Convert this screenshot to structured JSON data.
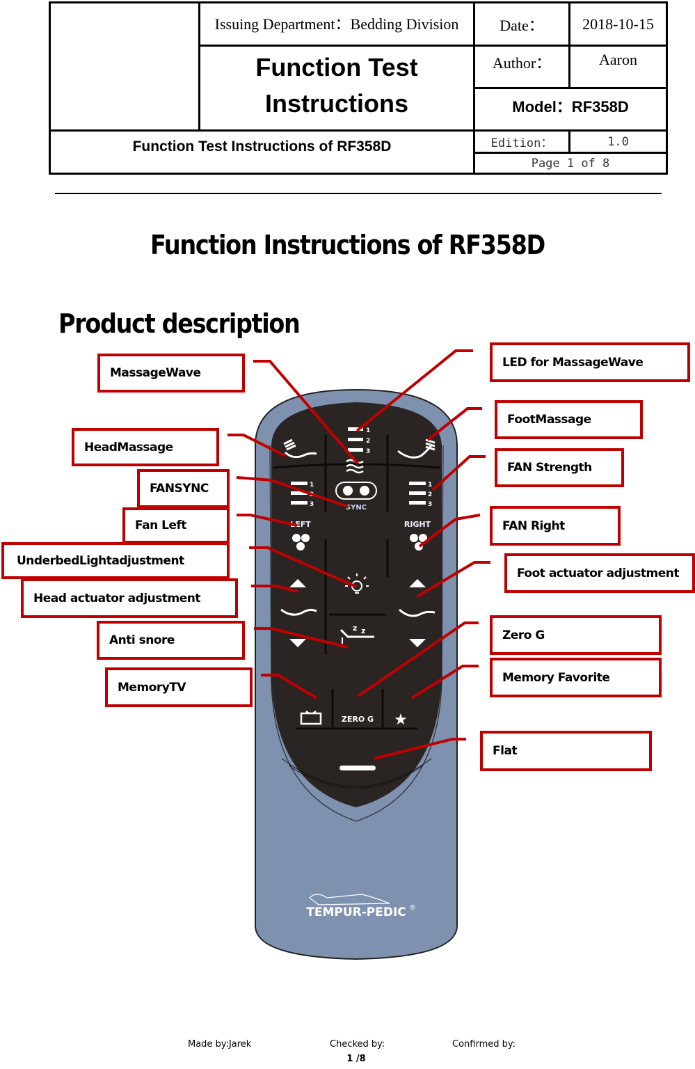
{
  "header": {
    "issuing_department": "Issuing Department：Bedding Division",
    "date_label": "Date：",
    "date_value": "2018-10-15",
    "doc_title": "Function Test Instructions",
    "author_label": "Author：",
    "author_value": "Aaron",
    "model": "Model：RF358D",
    "subtitle": "Function Test Instructions of RF358D",
    "edition_label": "Edition：",
    "edition_value": "1.0",
    "page": "Page 1 of 8"
  },
  "main_title": "Function Instructions of RF358D",
  "section_title": "Product description",
  "callouts": {
    "massage_wave": "MassageWave",
    "head_massage": "HeadMassage",
    "fan_sync": "FANSYNC",
    "fan_left": "Fan Left",
    "underbed_light": "UnderbedLightadjustment",
    "head_actuator": "Head actuator adjustment",
    "anti_snore": "Anti snore",
    "memory_tv": "MemoryTV",
    "led_massage_wave": "LED for MassageWave",
    "foot_massage": "FootMassage",
    "fan_strength": "FAN Strength",
    "fan_right": "FAN Right",
    "foot_actuator": "Foot actuator adjustment",
    "zero_g": "Zero G",
    "memory_favorite": "Memory Favorite",
    "flat": "Flat"
  },
  "remote": {
    "level_labels": [
      "1",
      "2",
      "3"
    ],
    "sync_label": "SYNC",
    "left_label": "LEFT",
    "right_label": "RIGHT",
    "zero_g_label": "ZERO G",
    "brand": "TEMPUR-PEDIC",
    "brand_mark": "®",
    "colors": {
      "casing": "#7e92b0",
      "face": "#2a2522",
      "icon": "#ffffff",
      "callout": "#c00000"
    }
  },
  "footer": {
    "made_by": "Made by:Jarek",
    "checked_by": "Checked by:",
    "confirmed_by": "Confirmed by:",
    "page_number": "1 /8"
  }
}
